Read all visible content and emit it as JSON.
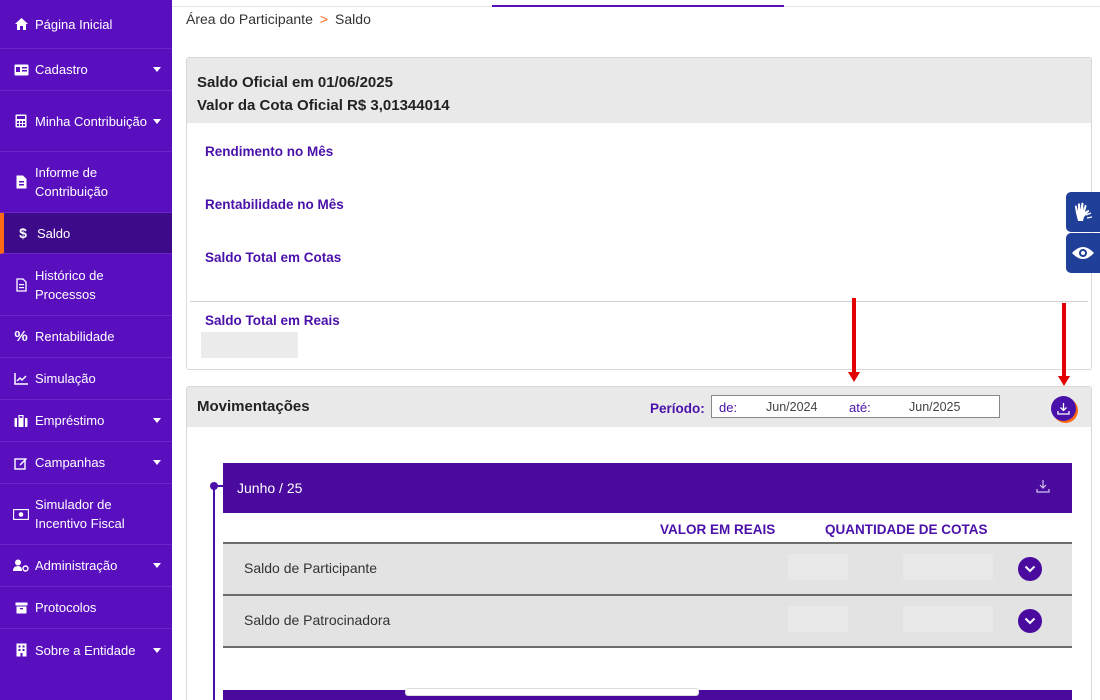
{
  "sidebar": {
    "items": [
      {
        "label": "Página Inicial",
        "icon": "home-icon"
      },
      {
        "label": "Cadastro",
        "icon": "id-card-icon"
      },
      {
        "label": "Minha Contribuição",
        "icon": "calculator-icon"
      },
      {
        "label": "Informe de Contribuição",
        "icon": "file-icon"
      },
      {
        "label": "Saldo",
        "icon": "dollar-icon"
      },
      {
        "label": "Histórico de Processos",
        "icon": "document-icon"
      },
      {
        "label": "Rentabilidade",
        "icon": "percent-icon"
      },
      {
        "label": "Simulação",
        "icon": "chart-line-icon"
      },
      {
        "label": "Empréstimo",
        "icon": "briefcase-icon"
      },
      {
        "label": "Campanhas",
        "icon": "edit-icon"
      },
      {
        "label": "Simulador de Incentivo Fiscal",
        "icon": "money-icon"
      },
      {
        "label": "Administração",
        "icon": "user-cog-icon"
      },
      {
        "label": "Protocolos",
        "icon": "archive-icon"
      },
      {
        "label": "Sobre a Entidade",
        "icon": "building-icon"
      }
    ],
    "active_item": "Saldo",
    "accent_color": "#5a0fbf",
    "active_indicator_color": "#ff6a13"
  },
  "breadcrumb": {
    "root": "Área do Participante",
    "separator": ">",
    "current": "Saldo"
  },
  "saldo": {
    "line1": "Saldo Oficial em 01/06/2025",
    "line2": "Valor da Cota Oficial R$ 3,01344014",
    "rendimento_label": "Rendimento no Mês",
    "rentabilidade_label": "Rentabilidade no Mês",
    "saldo_cotas_label": "Saldo Total em Cotas",
    "saldo_reais_label": "Saldo Total em Reais"
  },
  "movimentacoes": {
    "title": "Movimentações",
    "periodo_label": "Período:",
    "de_label": "de:",
    "de_value": "Jun/2024",
    "ate_label": "até:",
    "ate_value": "Jun/2025",
    "month_label": "Junho / 25",
    "col_valor": "VALOR EM REAIS",
    "col_cotas": "QUANTIDADE DE COTAS",
    "rows": [
      {
        "label": "Saldo de Participante"
      },
      {
        "label": "Saldo de Patrocinadora"
      }
    ]
  },
  "colors": {
    "primary_purple": "#4a0a9e",
    "annotation_red": "#e30000",
    "accessibility_blue": "#1f3f99"
  }
}
